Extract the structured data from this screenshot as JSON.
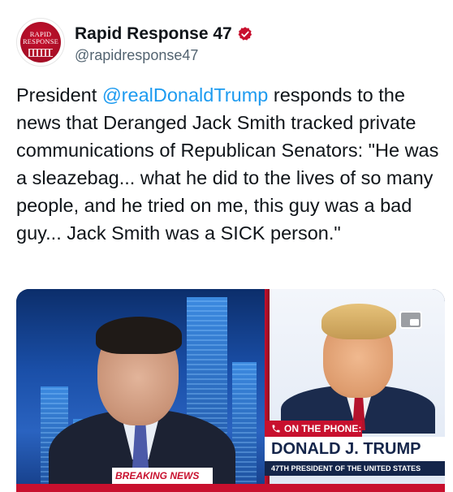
{
  "account": {
    "display_name": "Rapid Response 47",
    "handle": "@rapidresponse47",
    "avatar_text": "RAPID\nRESPONSE",
    "verified_icon": "verified-badge-icon",
    "brand_color": "#c8102e"
  },
  "tweet": {
    "text_before": "President ",
    "mention": "@realDonaldTrump",
    "text_after": " responds to the news that Deranged Jack Smith tracked private communications of Republican Senators: \"He was a sleazebag... what he did to the lives of so many people, and he tried on me, this guy was a bad guy... Jack Smith was a SICK person.\"",
    "mention_color": "#1d9bf0"
  },
  "media": {
    "breaking": "BREAKING NEWS",
    "on_phone": "ON THE PHONE:",
    "chyron_name": "DONALD J. TRUMP",
    "chyron_title": "47TH PRESIDENT OF THE UNITED STATES",
    "phone_icon": "phone-icon",
    "pip_icon": "picture-in-picture-icon"
  }
}
